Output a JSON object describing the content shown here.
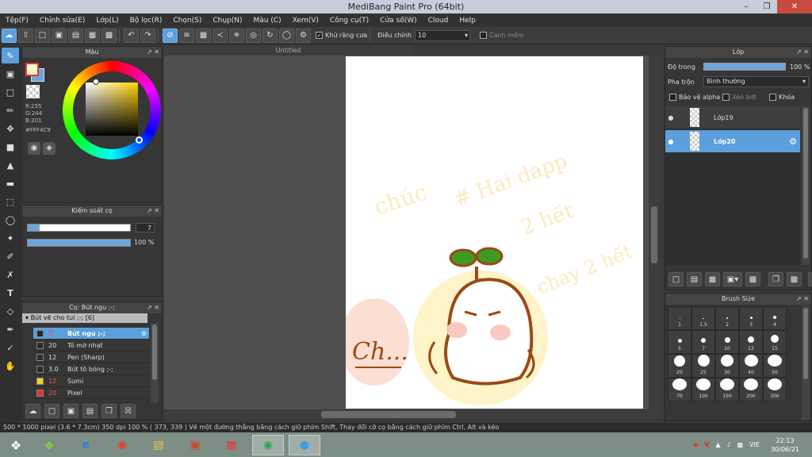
{
  "window": {
    "title": "MediBang Paint Pro (64bit)"
  },
  "menu": [
    "Tệp(F)",
    "Chỉnh sửa(E)",
    "Lớp(L)",
    "Bộ lọc(R)",
    "Chọn(S)",
    "Chụp(N)",
    "Màu (C)",
    "Xem(V)",
    "Công cụ(T)",
    "Cửa số(W)",
    "Cloud",
    "Help"
  ],
  "toolbar": {
    "antialias_label": "Khử răng cưa",
    "adjust_label": "Điều chỉnh",
    "adjust_value": "10",
    "edge_label": "Canh mềm"
  },
  "color_panel": {
    "title": "Màu",
    "r": "R:255",
    "g": "G:244",
    "b": "B:201",
    "hex": "#FFF4C9",
    "fg_color": "#fff4c9",
    "bg_color": "#6fa4db"
  },
  "brush_control": {
    "title": "Kiểm soát cọ",
    "size": "7",
    "opacity": "100 %",
    "opacity_value": 100,
    "size_fraction": 0.12
  },
  "brush_panel": {
    "title": "Cọ: Bút ngu ;-;",
    "group": "Bút vẽ cho tui ;-; [6]",
    "items": [
      {
        "size": "7",
        "name": "Bút ngu ;-;",
        "color": "#2a2a2a"
      },
      {
        "size": "20",
        "name": "Tô mờ nhạt",
        "color": "#2a2a2a"
      },
      {
        "size": "12",
        "name": "Pen (Sharp)",
        "color": "#2a2a2a"
      },
      {
        "size": "3.0",
        "name": "Bút tô bóng ;-;",
        "color": "#2a2a2a"
      },
      {
        "size": "12",
        "name": "Sumi",
        "color": "#f0d020"
      },
      {
        "size": "20",
        "name": "Pixel",
        "color": "#e03030"
      }
    ]
  },
  "canvas": {
    "tab": "Untitled"
  },
  "artwork_text": {
    "main": "Ch...",
    "faint1": "chúc",
    "faint2": "# Hai dapp",
    "faint3": "2 hết",
    "faint4": "chay 2 hết"
  },
  "layers_panel": {
    "title": "Lớp",
    "opacity_label": "Độ trong",
    "opacity_value": "100 %",
    "blend_label": "Pha trộn",
    "blend_value": "Bình thường",
    "protect_alpha": "Bảo vệ alpha",
    "clip": "Xén bớt",
    "lock": "Khóa",
    "layers": [
      "Lớp19",
      "Lớp20"
    ]
  },
  "brush_size_panel": {
    "title": "Brush Size",
    "sizes": [
      "1",
      "1.5",
      "2",
      "3",
      "4",
      "5",
      "7",
      "10",
      "12",
      "15",
      "20",
      "25",
      "30",
      "40",
      "50",
      "70",
      "100",
      "150",
      "200",
      "300"
    ]
  },
  "status": {
    "text": "500 * 1000 pixel   (3.6 * 7.3cm)   350 dpi   100 %   ( 373, 339 )   Vẽ một đường thẳng bằng cách giữ phím Shift, Thay đổi cỡ cọ bằng cách giữ phím Ctrl, Alt và kéo"
  },
  "taskbar": {
    "lang": "VIE",
    "time": "22:13",
    "date": "30/06/21"
  }
}
